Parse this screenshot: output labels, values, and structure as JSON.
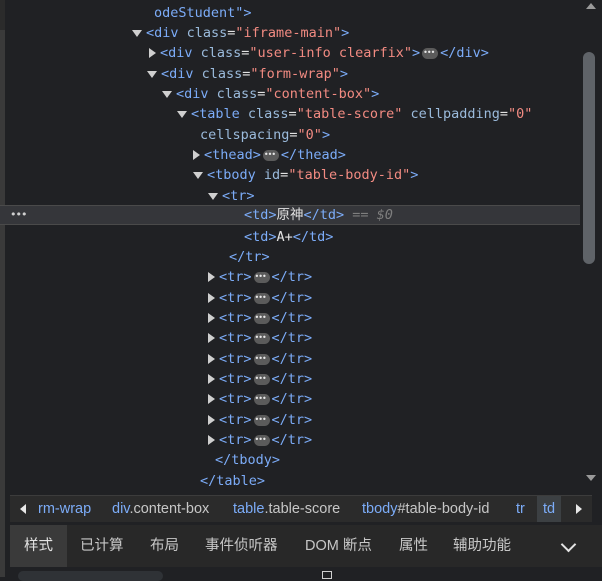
{
  "elements_tree": {
    "lines": [
      [
        {
          "c": "tag",
          "t": "odeStudent\">"
        }
      ],
      [
        {
          "c": "tag",
          "t": "<div "
        },
        {
          "c": "attr",
          "t": "class"
        },
        {
          "c": "txt",
          "t": "="
        },
        {
          "c": "val",
          "t": "\"iframe-main\""
        },
        {
          "c": "tag",
          "t": ">"
        }
      ],
      [
        {
          "c": "tag",
          "t": "<div "
        },
        {
          "c": "attr",
          "t": "class"
        },
        {
          "c": "txt",
          "t": "="
        },
        {
          "c": "val",
          "t": "\"user-info clearfix\""
        },
        {
          "c": "tag",
          "t": ">"
        },
        {
          "c": "ell",
          "t": ""
        },
        {
          "c": "tag",
          "t": "</div>"
        }
      ],
      [
        {
          "c": "tag",
          "t": "<div "
        },
        {
          "c": "attr",
          "t": "class"
        },
        {
          "c": "txt",
          "t": "="
        },
        {
          "c": "val",
          "t": "\"form-wrap\""
        },
        {
          "c": "tag",
          "t": ">"
        }
      ],
      [
        {
          "c": "tag",
          "t": "<div "
        },
        {
          "c": "attr",
          "t": "class"
        },
        {
          "c": "txt",
          "t": "="
        },
        {
          "c": "val",
          "t": "\"content-box\""
        },
        {
          "c": "tag",
          "t": ">"
        }
      ],
      [
        {
          "c": "tag",
          "t": "<table "
        },
        {
          "c": "attr",
          "t": "class"
        },
        {
          "c": "txt",
          "t": "="
        },
        {
          "c": "val",
          "t": "\"table-score\""
        },
        {
          "c": "txt",
          "t": " "
        },
        {
          "c": "attr",
          "t": "cellpadding"
        },
        {
          "c": "txt",
          "t": "="
        },
        {
          "c": "val",
          "t": "\"0\""
        }
      ],
      [
        {
          "c": "attr",
          "t": "cellspacing"
        },
        {
          "c": "txt",
          "t": "="
        },
        {
          "c": "val",
          "t": "\"0\""
        },
        {
          "c": "tag",
          "t": ">"
        }
      ],
      [
        {
          "c": "tag",
          "t": "<thead>"
        },
        {
          "c": "ell",
          "t": ""
        },
        {
          "c": "tag",
          "t": "</thead>"
        }
      ],
      [
        {
          "c": "tag",
          "t": "<tbody "
        },
        {
          "c": "attr",
          "t": "id"
        },
        {
          "c": "txt",
          "t": "="
        },
        {
          "c": "val",
          "t": "\"table-body-id\""
        },
        {
          "c": "tag",
          "t": ">"
        }
      ],
      [
        {
          "c": "tag",
          "t": "<tr>"
        }
      ],
      [
        {
          "c": "tag",
          "t": "<td>"
        },
        {
          "c": "txt",
          "t": "原神"
        },
        {
          "c": "tag",
          "t": "</td>"
        },
        {
          "c": "eqs",
          "t": " == $0"
        }
      ],
      [
        {
          "c": "tag",
          "t": "<td>"
        },
        {
          "c": "txt",
          "t": "A+"
        },
        {
          "c": "tag",
          "t": "</td>"
        }
      ],
      [
        {
          "c": "tag",
          "t": "</tr>"
        }
      ],
      [
        {
          "c": "tag",
          "t": "<tr>"
        },
        {
          "c": "ell",
          "t": ""
        },
        {
          "c": "tag",
          "t": "</tr>"
        }
      ],
      [
        {
          "c": "tag",
          "t": "<tr>"
        },
        {
          "c": "ell",
          "t": ""
        },
        {
          "c": "tag",
          "t": "</tr>"
        }
      ],
      [
        {
          "c": "tag",
          "t": "<tr>"
        },
        {
          "c": "ell",
          "t": ""
        },
        {
          "c": "tag",
          "t": "</tr>"
        }
      ],
      [
        {
          "c": "tag",
          "t": "<tr>"
        },
        {
          "c": "ell",
          "t": ""
        },
        {
          "c": "tag",
          "t": "</tr>"
        }
      ],
      [
        {
          "c": "tag",
          "t": "<tr>"
        },
        {
          "c": "ell",
          "t": ""
        },
        {
          "c": "tag",
          "t": "</tr>"
        }
      ],
      [
        {
          "c": "tag",
          "t": "<tr>"
        },
        {
          "c": "ell",
          "t": ""
        },
        {
          "c": "tag",
          "t": "</tr>"
        }
      ],
      [
        {
          "c": "tag",
          "t": "<tr>"
        },
        {
          "c": "ell",
          "t": ""
        },
        {
          "c": "tag",
          "t": "</tr>"
        }
      ],
      [
        {
          "c": "tag",
          "t": "<tr>"
        },
        {
          "c": "ell",
          "t": ""
        },
        {
          "c": "tag",
          "t": "</tr>"
        }
      ],
      [
        {
          "c": "tag",
          "t": "<tr>"
        },
        {
          "c": "ell",
          "t": ""
        },
        {
          "c": "tag",
          "t": "</tr>"
        }
      ],
      [
        {
          "c": "tag",
          "t": "</tbody>"
        }
      ],
      [
        {
          "c": "tag",
          "t": "</table>"
        }
      ]
    ],
    "toggles": [
      "none",
      "down",
      "right",
      "down",
      "down",
      "down",
      "none",
      "right",
      "down",
      "down",
      "none",
      "none",
      "none",
      "right",
      "right",
      "right",
      "right",
      "right",
      "right",
      "right",
      "right",
      "right",
      "none",
      "none"
    ],
    "selected_row_dots": "•••"
  },
  "breadcrumbs": {
    "items": [
      {
        "tag": "",
        "rest": "rm-wrap"
      },
      {
        "tag": "div",
        "rest": ".content-box"
      },
      {
        "tag": "table",
        "rest": ".table-score"
      },
      {
        "tag": "tbody",
        "rest": "#table-body-id"
      },
      {
        "tag": "tr",
        "rest": ""
      },
      {
        "tag": "td",
        "rest": ""
      }
    ]
  },
  "tabs": {
    "items": [
      "样式",
      "已计算",
      "布局",
      "事件侦听器",
      "DOM 断点",
      "属性",
      "辅助功能"
    ]
  },
  "colors": {
    "background": "#202124",
    "tag": "#7cacf8",
    "attribute": "#9bbbdc",
    "value": "#f28b82",
    "text": "#e3e3e3"
  }
}
